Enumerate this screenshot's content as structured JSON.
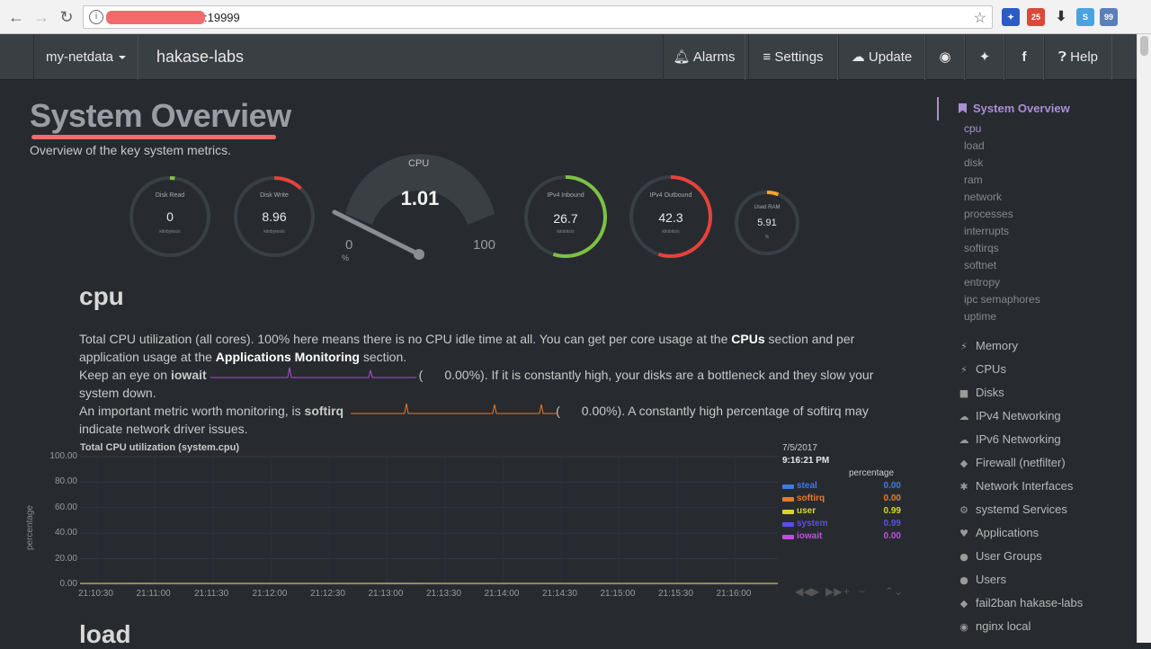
{
  "browser": {
    "url_suffix": ":19999"
  },
  "navbar": {
    "host_menu": "my-netdata",
    "hostname": "hakase-labs",
    "alarms": "Alarms",
    "settings": "Settings",
    "update": "Update",
    "help": "Help"
  },
  "page": {
    "title": "System Overview",
    "subtitle": "Overview of the key system metrics."
  },
  "gauges": {
    "disk_read": {
      "title": "Disk Read",
      "value": "0",
      "unit": "kilobytes/s",
      "fraction": 0.02,
      "color": "#7cc242"
    },
    "disk_write": {
      "title": "Disk Write",
      "value": "8.96",
      "unit": "kilobytes/s",
      "fraction": 0.12,
      "color": "#e8413a"
    },
    "cpu": {
      "title": "CPU",
      "value": "1.01",
      "min": "0",
      "max": "100",
      "unit": "%"
    },
    "ipv4_in": {
      "title": "IPv4 Inbound",
      "value": "26.7",
      "unit": "kilobits/s",
      "fraction": 0.55,
      "color": "#7cc242"
    },
    "ipv4_out": {
      "title": "IPv4 Outbound",
      "value": "42.3",
      "unit": "kilobits/s",
      "fraction": 0.55,
      "color": "#e8413a"
    },
    "used_ram": {
      "title": "Used RAM",
      "value": "5.91",
      "unit": "%",
      "fraction": 0.06,
      "color": "#f5a623"
    }
  },
  "cpu_section": {
    "heading": "cpu",
    "p1_a": "Total CPU utilization (all cores). 100% here means there is no CPU idle time at all. You can get per core usage at the ",
    "p1_cpus": "CPUs",
    "p1_b": " section and per",
    "p1_c": "application usage at the ",
    "p1_apps": "Applications Monitoring",
    "p1_d": " section.",
    "p2_a": "Keep an eye on ",
    "p2_iowait": "iowait",
    "p2_open": "(",
    "p2_val": "0.00%",
    "p2_b": "). If it is constantly high, your disks are a bottleneck and they slow your",
    "p2_c": "system down.",
    "p3_a": "An important metric worth monitoring, is ",
    "p3_softirq": "softirq",
    "p3_open": "(",
    "p3_val": "0.00%",
    "p3_b": "). A constantly high percentage of softirq may",
    "p3_c": "indicate network driver issues."
  },
  "load_section": {
    "heading": "load"
  },
  "chart_data": {
    "type": "area",
    "title": "Total CPU utilization (system.cpu)",
    "ylabel": "percentage",
    "ylim": [
      0,
      100
    ],
    "yticks": [
      "100.00",
      "80.00",
      "60.00",
      "40.00",
      "20.00",
      "0.00"
    ],
    "xticks": [
      "21:10:30",
      "21:11:00",
      "21:11:30",
      "21:12:00",
      "21:12:30",
      "21:13:00",
      "21:13:30",
      "21:14:00",
      "21:14:30",
      "21:15:00",
      "21:15:30",
      "21:16:00"
    ],
    "legend_date": "7/5/2017",
    "legend_time": "9:16:21 PM",
    "legend_header": "percentage",
    "series": [
      {
        "name": "steal",
        "value": "0.00",
        "color": "#3e7ae8"
      },
      {
        "name": "softirq",
        "value": "0.00",
        "color": "#e87a2a"
      },
      {
        "name": "user",
        "value": "0.99",
        "color": "#d7d72a"
      },
      {
        "name": "system",
        "value": "0.99",
        "color": "#5a4ee8"
      },
      {
        "name": "iowait",
        "value": "0.00",
        "color": "#c050e0"
      }
    ],
    "approx_total": [
      1.0,
      1.2,
      0.9,
      1.1,
      1.0,
      1.3,
      1.0,
      0.9,
      1.1,
      1.0,
      1.2,
      1.0
    ]
  },
  "sidebar": {
    "active": "System Overview",
    "subs": [
      "cpu",
      "load",
      "disk",
      "ram",
      "network",
      "processes",
      "interrupts",
      "softirqs",
      "softnet",
      "entropy",
      "ipc semaphores",
      "uptime"
    ],
    "items": [
      {
        "label": "Memory",
        "icon": "bolt-icon"
      },
      {
        "label": "CPUs",
        "icon": "bolt-icon"
      },
      {
        "label": "Disks",
        "icon": "folder-icon"
      },
      {
        "label": "IPv4 Networking",
        "icon": "cloud-icon"
      },
      {
        "label": "IPv6 Networking",
        "icon": "cloud-icon"
      },
      {
        "label": "Firewall (netfilter)",
        "icon": "shield-icon"
      },
      {
        "label": "Network Interfaces",
        "icon": "share-icon"
      },
      {
        "label": "systemd Services",
        "icon": "gears-icon"
      },
      {
        "label": "Applications",
        "icon": "heartbeat-icon"
      },
      {
        "label": "User Groups",
        "icon": "users-icon"
      },
      {
        "label": "Users",
        "icon": "user-icon"
      },
      {
        "label": "fail2ban hakase-labs",
        "icon": "shield-icon"
      },
      {
        "label": "nginx local",
        "icon": "eye-icon"
      }
    ]
  }
}
